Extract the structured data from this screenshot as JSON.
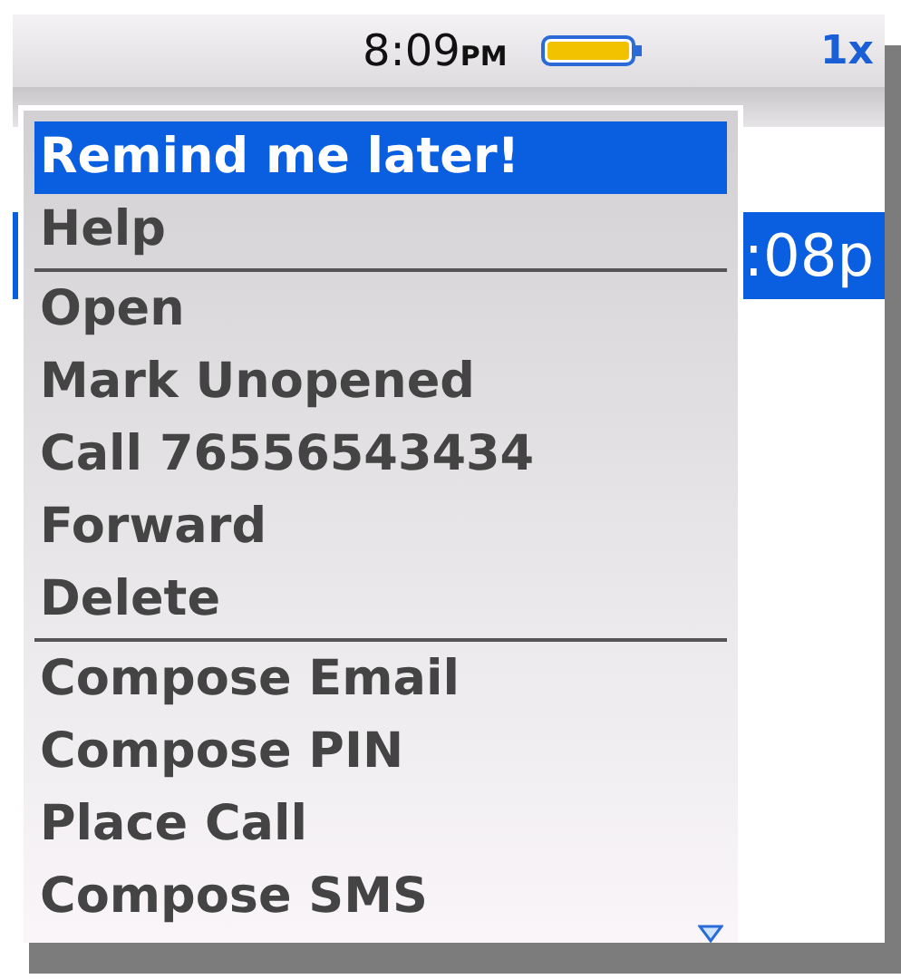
{
  "status_bar": {
    "time": "8:09",
    "time_suffix": "PM",
    "indicator": "1x"
  },
  "background_list": {
    "row_text": ":08p",
    "selected": true
  },
  "menu": {
    "groups": [
      [
        {
          "label": "Remind me later!",
          "selected": true
        },
        {
          "label": "Help",
          "selected": false
        }
      ],
      [
        {
          "label": "Open",
          "selected": false
        },
        {
          "label": "Mark Unopened",
          "selected": false
        },
        {
          "label": "Call 76556543434",
          "selected": false
        },
        {
          "label": "Forward",
          "selected": false
        },
        {
          "label": "Delete",
          "selected": false
        }
      ],
      [
        {
          "label": "Compose Email",
          "selected": false
        },
        {
          "label": "Compose PIN",
          "selected": false
        },
        {
          "label": "Place Call",
          "selected": false
        },
        {
          "label": "Compose SMS",
          "selected": false
        }
      ]
    ],
    "more_below": true
  }
}
